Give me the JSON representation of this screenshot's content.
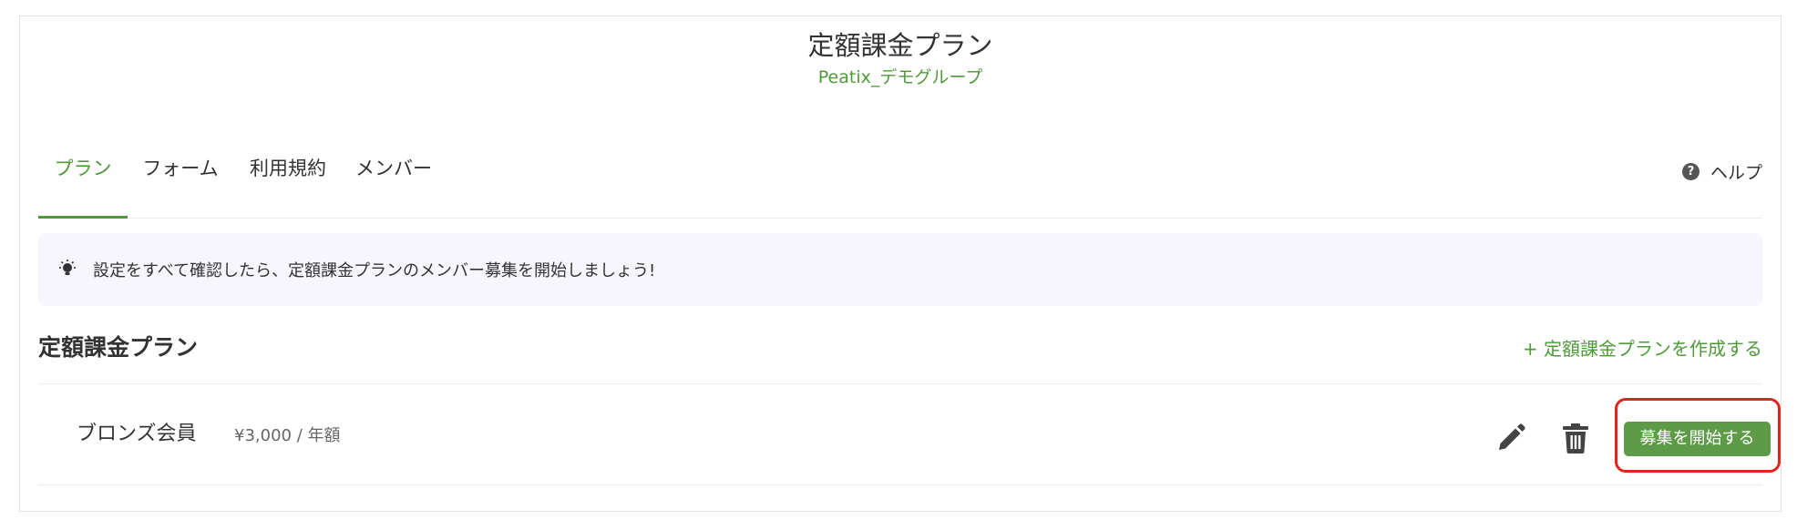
{
  "header": {
    "title": "定額課金プラン",
    "group_name": "Peatix_デモグループ"
  },
  "tabs": [
    {
      "label": "プラン",
      "active": true
    },
    {
      "label": "フォーム",
      "active": false
    },
    {
      "label": "利用規約",
      "active": false
    },
    {
      "label": "メンバー",
      "active": false
    }
  ],
  "help": {
    "label": "ヘルプ",
    "icon": "question-circle-icon"
  },
  "notice": {
    "icon": "lightbulb-icon",
    "text": "設定をすべて確認したら、定額課金プランのメンバー募集を開始しましょう!"
  },
  "section": {
    "title": "定額課金プラン",
    "create_link": "+ 定額課金プランを作成する"
  },
  "plans": [
    {
      "name": "ブロンズ会員",
      "price": "¥3,000 / 年額",
      "start_label": "募集を開始する",
      "highlighted": true
    }
  ],
  "colors": {
    "accent": "#4f9a3a",
    "button": "#5e9b48",
    "highlight": "#e0261c",
    "notice_bg": "#f6f6fc"
  }
}
